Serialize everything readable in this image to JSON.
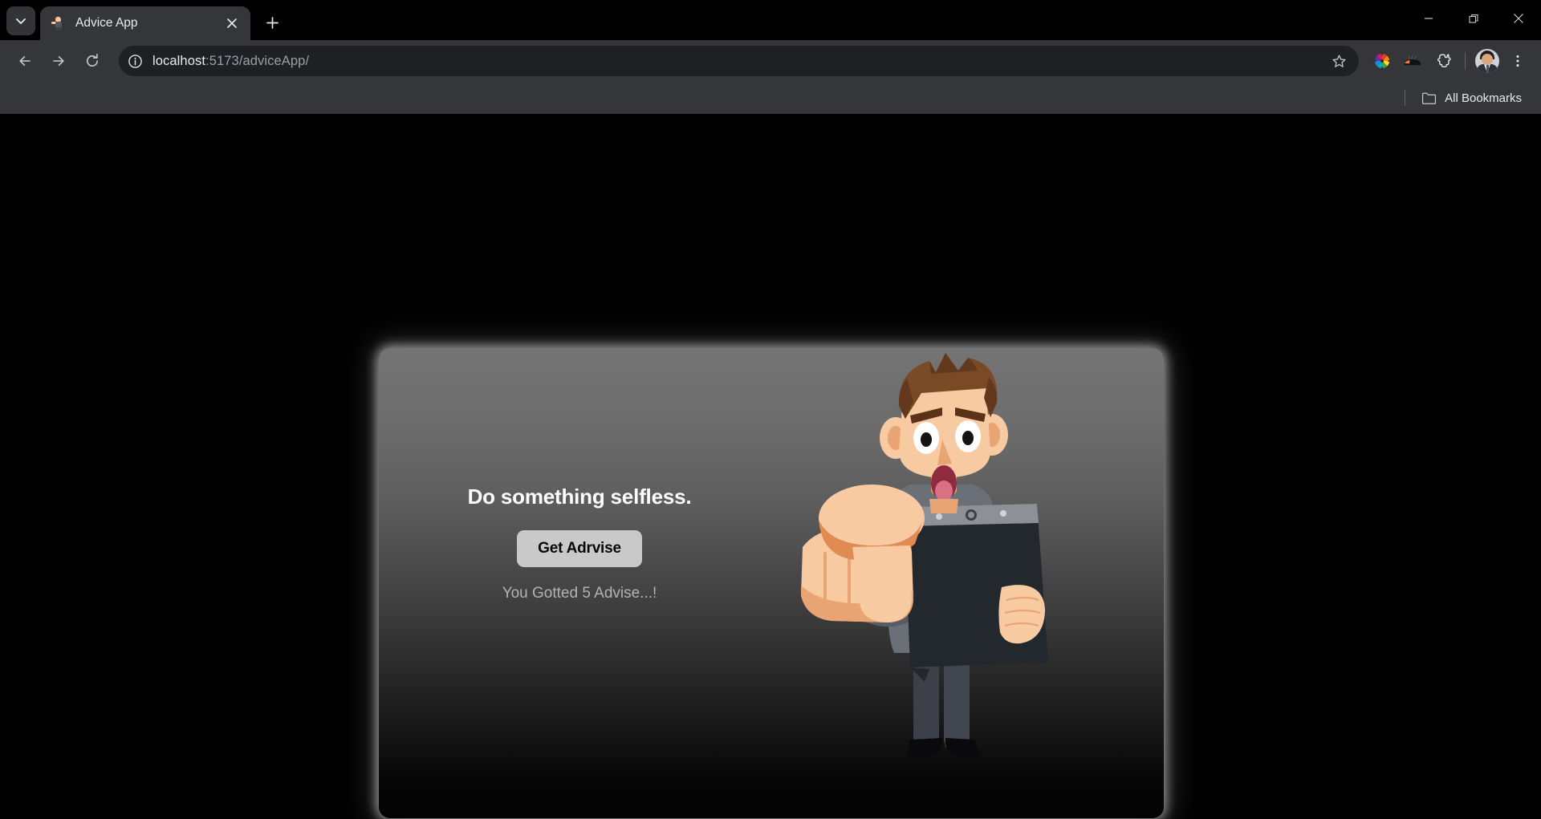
{
  "browser": {
    "tab": {
      "title": "Advice App",
      "favicon": "advice-app-favicon",
      "close_label": "×",
      "new_tab_label": "+"
    },
    "tab_search_label": "Search tabs",
    "window_controls": {
      "minimize": "—",
      "maximize": "Restore",
      "close": "×"
    },
    "toolbar": {
      "back_label": "Back",
      "forward_label": "Forward",
      "reload_label": "Reload",
      "site_info_label": "View site information",
      "url_host": "localhost",
      "url_rest": ":5173/adviceApp/",
      "bookmark_label": "Bookmark this tab",
      "extension_color_label": "color-wheel-extension",
      "extension_dark_label": "dark-extension",
      "extensions_label": "Extensions",
      "profile_label": "Profile",
      "menu_label": "Customize and control Google Chrome"
    },
    "bookmarks_bar": {
      "all_bookmarks_label": "All Bookmarks",
      "folder_icon": "folder-icon"
    }
  },
  "page": {
    "advice_text": "Do something selfless.",
    "button_label": "Get Adrvise",
    "counter_text": "You Gotted 5 Advise...!",
    "colors": {
      "card_top": "#747474",
      "card_bottom": "#030303",
      "button_bg": "#c9c9c9",
      "button_text": "#07070a",
      "advice_text": "#ffffff",
      "counter_text": "#b3b3b3",
      "page_bg": "#000000",
      "tie": "#1f8fd4",
      "skin": "#f8caa2",
      "skin_shade": "#e08b52",
      "hair": "#7a4a27",
      "suit": "#6b6f77",
      "trousers": "#3f434b",
      "clipboard": "#23272e"
    },
    "illustration": "pointing-man-with-clipboard"
  }
}
